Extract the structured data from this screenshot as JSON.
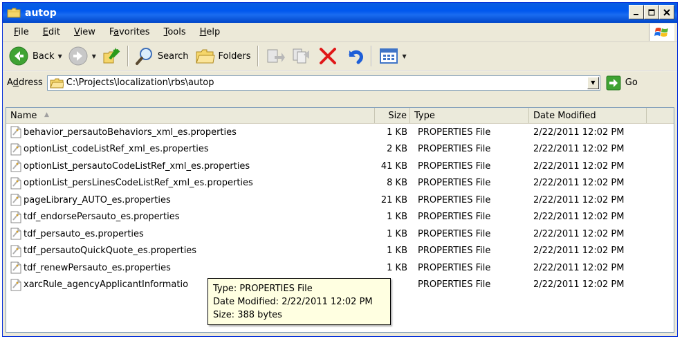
{
  "window": {
    "title": "autop"
  },
  "menu": {
    "items": [
      {
        "label": "File",
        "accel": "F",
        "rest": "ile"
      },
      {
        "label": "Edit",
        "accel": "E",
        "rest": "dit"
      },
      {
        "label": "View",
        "accel": "V",
        "rest": "iew"
      },
      {
        "label": "Favorites",
        "accel": "a",
        "pre": "F",
        "rest": "vorites"
      },
      {
        "label": "Tools",
        "accel": "T",
        "rest": "ools"
      },
      {
        "label": "Help",
        "accel": "H",
        "rest": "elp"
      }
    ]
  },
  "toolbar": {
    "back_label": "Back",
    "search_label": "Search",
    "folders_label": "Folders"
  },
  "address": {
    "label_pre": "A",
    "label_accel": "d",
    "label_rest": "dress",
    "path": "C:\\Projects\\localization\\rbs\\autop",
    "go_label": "Go"
  },
  "columns": {
    "name": "Name",
    "size": "Size",
    "type": "Type",
    "date": "Date Modified"
  },
  "files": [
    {
      "name": "behavior_persautoBehaviors_xml_es.properties",
      "size": "1 KB",
      "type": "PROPERTIES File",
      "date": "2/22/2011 12:02 PM"
    },
    {
      "name": "optionList_codeListRef_xml_es.properties",
      "size": "2 KB",
      "type": "PROPERTIES File",
      "date": "2/22/2011 12:02 PM"
    },
    {
      "name": "optionList_persautoCodeListRef_xml_es.properties",
      "size": "41 KB",
      "type": "PROPERTIES File",
      "date": "2/22/2011 12:02 PM"
    },
    {
      "name": "optionList_persLinesCodeListRef_xml_es.properties",
      "size": "8 KB",
      "type": "PROPERTIES File",
      "date": "2/22/2011 12:02 PM"
    },
    {
      "name": "pageLibrary_AUTO_es.properties",
      "size": "21 KB",
      "type": "PROPERTIES File",
      "date": "2/22/2011 12:02 PM"
    },
    {
      "name": "tdf_endorsePersauto_es.properties",
      "size": "1 KB",
      "type": "PROPERTIES File",
      "date": "2/22/2011 12:02 PM"
    },
    {
      "name": "tdf_persauto_es.properties",
      "size": "1 KB",
      "type": "PROPERTIES File",
      "date": "2/22/2011 12:02 PM"
    },
    {
      "name": "tdf_persautoQuickQuote_es.properties",
      "size": "1 KB",
      "type": "PROPERTIES File",
      "date": "2/22/2011 12:02 PM"
    },
    {
      "name": "tdf_renewPersauto_es.properties",
      "size": "1 KB",
      "type": "PROPERTIES File",
      "date": "2/22/2011 12:02 PM"
    },
    {
      "name": "xarcRule_agencyApplicantInformatio",
      "size": "",
      "type": "PROPERTIES File",
      "date": "2/22/2011 12:02 PM"
    }
  ],
  "tooltip": {
    "type_line": "Type: PROPERTIES File",
    "date_line": "Date Modified: 2/22/2011 12:02 PM",
    "size_line": "Size: 388 bytes"
  }
}
